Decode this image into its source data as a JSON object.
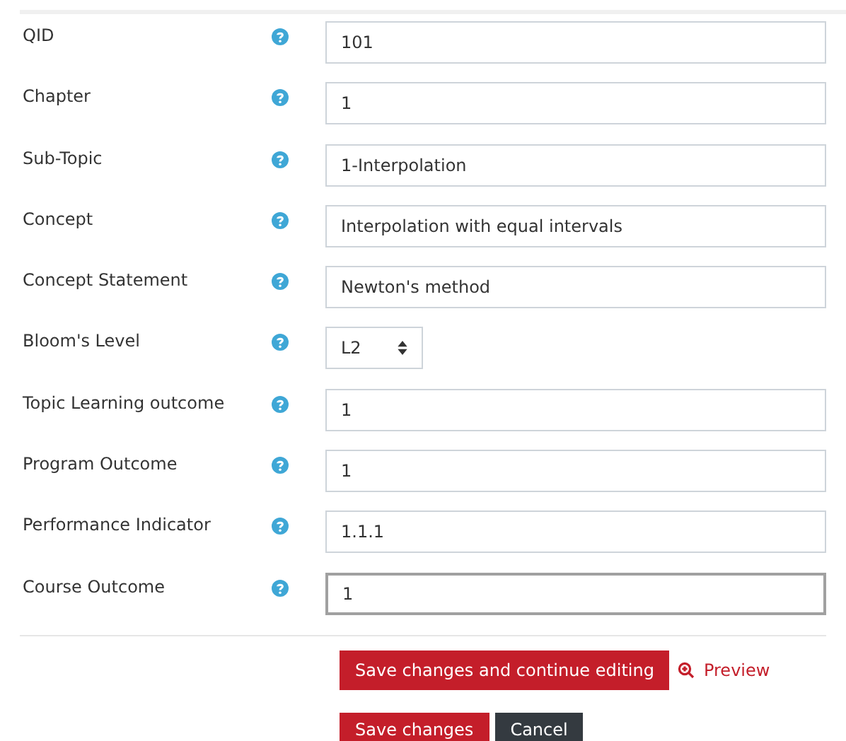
{
  "fields": [
    {
      "label": "QID",
      "kind": "text",
      "value": "101",
      "focused": false
    },
    {
      "label": "Chapter",
      "kind": "text",
      "value": "1",
      "focused": false
    },
    {
      "label": "Sub-Topic",
      "kind": "text",
      "value": "1-Interpolation",
      "focused": false
    },
    {
      "label": "Concept",
      "kind": "text",
      "value": "Interpolation with equal intervals",
      "focused": false
    },
    {
      "label": "Concept Statement",
      "kind": "text",
      "value": "Newton's method",
      "focused": false
    },
    {
      "label": "Bloom's Level",
      "kind": "select",
      "value": "L2",
      "focused": false
    },
    {
      "label": "Topic Learning outcome",
      "kind": "text",
      "value": "1",
      "focused": false
    },
    {
      "label": "Program Outcome",
      "kind": "text",
      "value": "1",
      "focused": false
    },
    {
      "label": "Performance Indicator",
      "kind": "text",
      "value": "1.1.1",
      "focused": false
    },
    {
      "label": "Course Outcome",
      "kind": "text",
      "value": "1",
      "focused": true
    }
  ],
  "actions": {
    "save_continue": "Save changes and continue editing",
    "preview": "Preview",
    "save": "Save changes",
    "cancel": "Cancel"
  }
}
